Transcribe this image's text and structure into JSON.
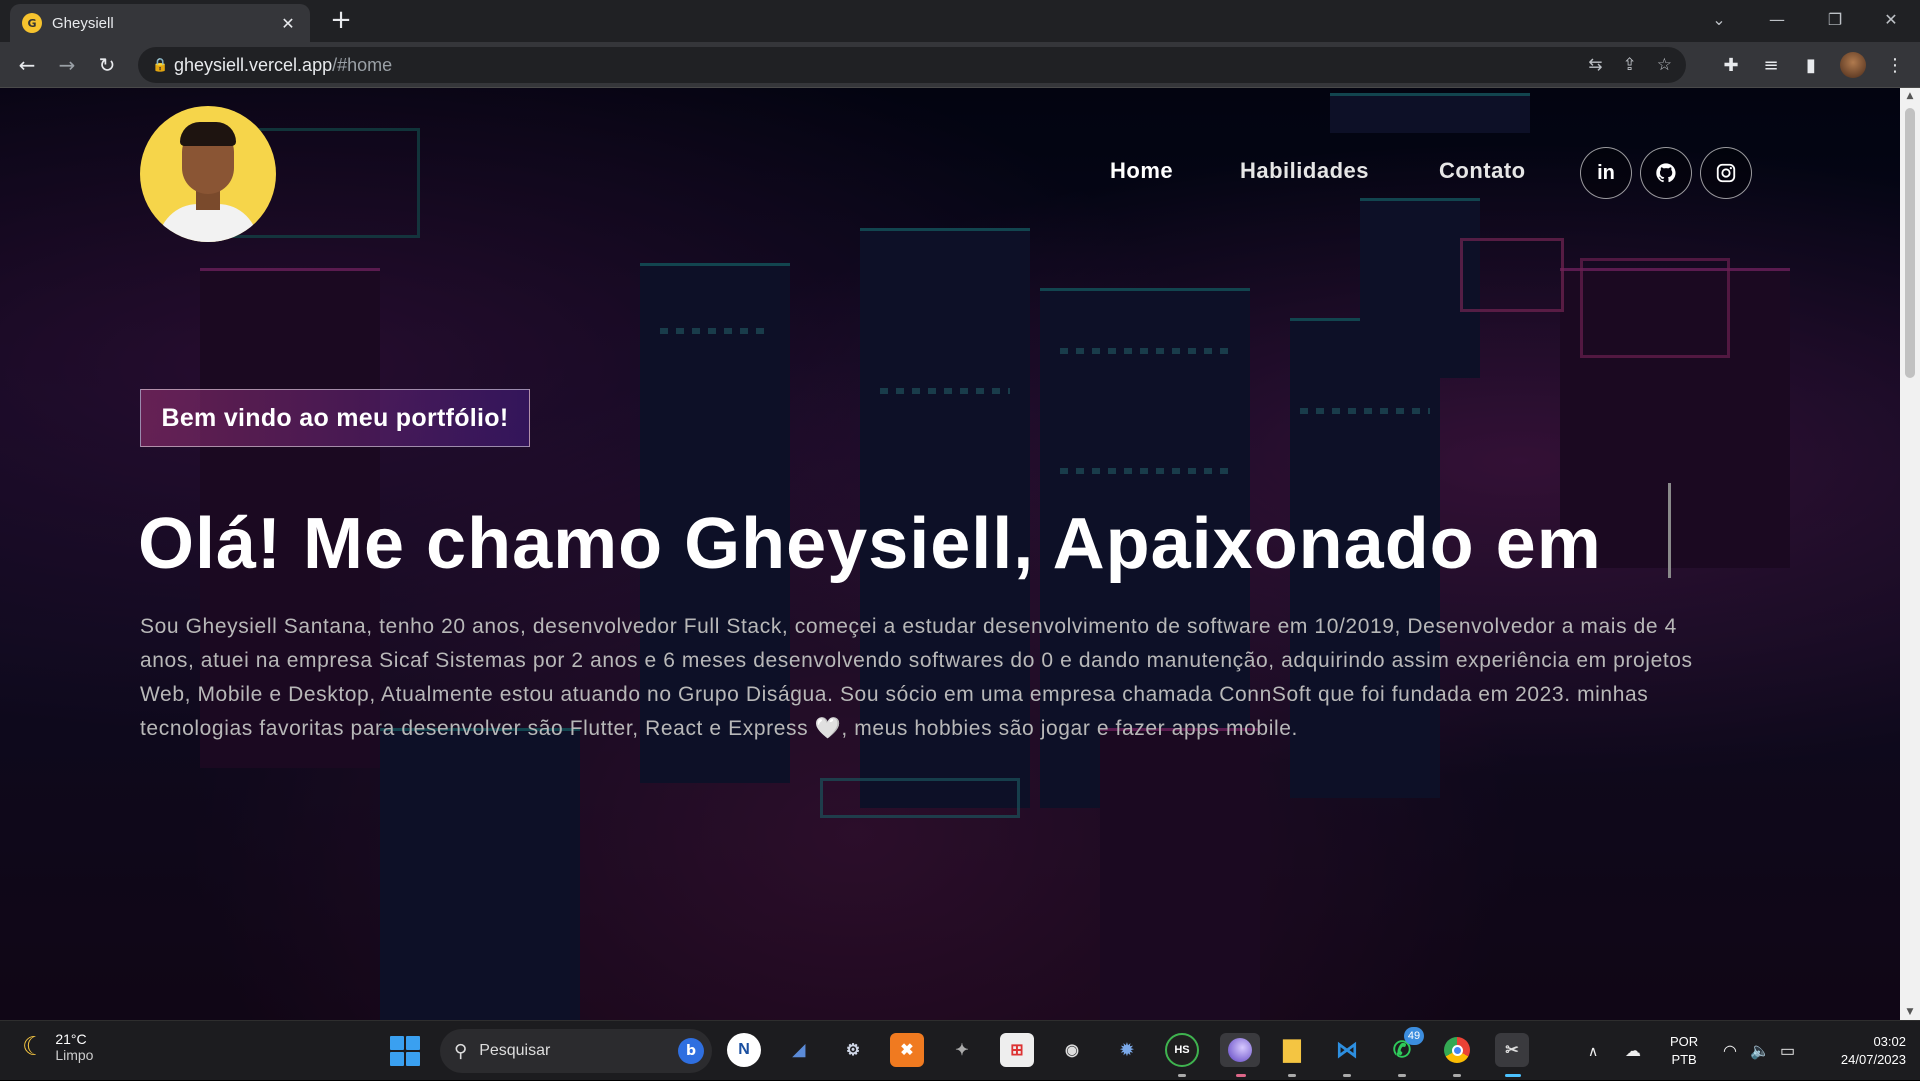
{
  "browser": {
    "tab_title": "Gheysiell",
    "tab_favicon_icon": "g-logo-icon",
    "url_host": "gheysiell.vercel.app",
    "url_path": "/#home"
  },
  "site": {
    "nav": {
      "home": "Home",
      "skills": "Habilidades",
      "contact": "Contato"
    },
    "social": [
      "linkedin-icon",
      "github-icon",
      "instagram-icon"
    ],
    "social_labels": {
      "linkedin": "in"
    },
    "tagline": "Bem vindo ao meu portfólio!",
    "headline": "Olá! Me chamo Gheysiell, Apaixonado em",
    "about": "Sou Gheysiell Santana, tenho 20 anos, desenvolvedor Full Stack, começei a estudar desenvolvimento de software em 10/2019, Desenvolvedor a mais de 4 anos, atuei na empresa Sicaf Sistemas por 2 anos e 6 meses desenvolvendo softwares do 0 e dando manutenção, adquirindo assim experiência em projetos Web, Mobile e Desktop, Atualmente estou atuando no Grupo Diságua. Sou sócio em uma empresa chamada ConnSoft que foi fundada em 2023. minhas tecnologias favoritas para desenvolver são Flutter, React e Express 🤍, meus hobbies são jogar e fazer apps mobile."
  },
  "taskbar": {
    "weather_temp": "21°C",
    "weather_desc": "Limpo",
    "search_placeholder": "Pesquisar",
    "lang_line1": "POR",
    "lang_line2": "PTB",
    "time": "03:02",
    "date": "24/07/2023",
    "whatsapp_badge": "49",
    "hs_label": "HS"
  },
  "colors": {
    "accent_pink": "#aa367c",
    "accent_purple": "#4a2fbd",
    "avatar_bg": "#f6d54a"
  }
}
